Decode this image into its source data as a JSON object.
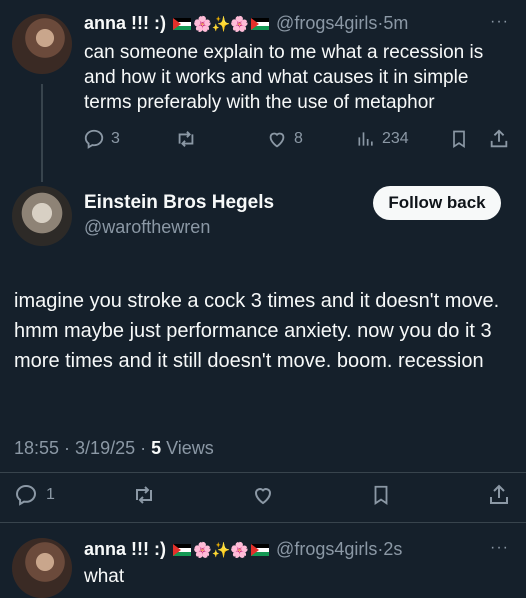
{
  "tweet1": {
    "name": "anna !!! :)",
    "emojis": "🌸✨🌸",
    "handle": "@frogs4girls",
    "sep": "·",
    "time": "5m",
    "more": "···",
    "text": "can someone explain to me what a recession is and how it works and what causes it in simple terms preferably with the use of metaphor",
    "replies": "3",
    "likes": "8",
    "views": "234"
  },
  "tweet2": {
    "name": "Einstein Bros Hegels",
    "handle": "@warofthewren",
    "follow_label": "Follow back",
    "text": "imagine you stroke a cock 3 times and it doesn't move. hmm maybe just performance anxiety. now you do it 3 more times and it still doesn't move. boom. recession",
    "meta_time": "18:55 · 3/19/25 · ",
    "meta_views_count": "5",
    "meta_views_label": " Views",
    "replies": "1"
  },
  "tweet3": {
    "name": "anna !!! :)",
    "emojis": "🌸✨🌸",
    "handle": "@frogs4girls",
    "sep": "·",
    "time": "2s",
    "more": "···",
    "text": "what"
  },
  "colors": {
    "background": "#15202b",
    "text": "#f7f9f9",
    "muted": "#8b98a5",
    "divider": "#38444d"
  }
}
